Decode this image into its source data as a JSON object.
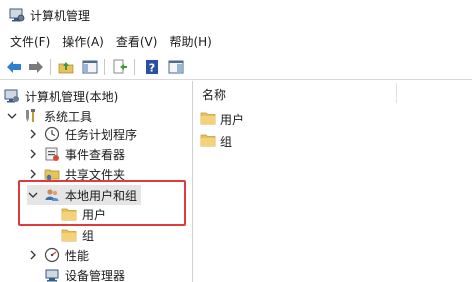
{
  "window": {
    "title": "计算机管理"
  },
  "menu": [
    {
      "label": "文件(F)"
    },
    {
      "label": "操作(A)"
    },
    {
      "label": "查看(V)"
    },
    {
      "label": "帮助(H)"
    }
  ],
  "toolbar": {
    "buttons": [
      "back-icon",
      "forward-icon",
      "up-folder-icon",
      "show-hide-tree-icon",
      "export-list-icon",
      "help-icon",
      "properties-icon"
    ]
  },
  "tree": {
    "items": [
      {
        "label": "计算机管理(本地)",
        "icon": "computer-management-icon",
        "expander": ""
      },
      {
        "label": "系统工具",
        "icon": "system-tools-icon",
        "expander": "expanded"
      },
      {
        "label": "任务计划程序",
        "icon": "task-scheduler-icon",
        "expander": "collapsed"
      },
      {
        "label": "事件查看器",
        "icon": "event-viewer-icon",
        "expander": "collapsed"
      },
      {
        "label": "共享文件夹",
        "icon": "shared-folders-icon",
        "expander": "collapsed"
      },
      {
        "label": "本地用户和组",
        "icon": "local-users-groups-icon",
        "expander": "expanded"
      },
      {
        "label": "用户",
        "icon": "folder-icon",
        "expander": ""
      },
      {
        "label": "组",
        "icon": "folder-icon",
        "expander": ""
      },
      {
        "label": "性能",
        "icon": "performance-icon",
        "expander": "collapsed"
      },
      {
        "label": "设备管理器",
        "icon": "device-manager-icon",
        "expander": ""
      }
    ]
  },
  "list": {
    "header": {
      "name": "名称"
    },
    "rows": [
      {
        "label": "用户",
        "icon": "folder-icon"
      },
      {
        "label": "组",
        "icon": "folder-icon"
      }
    ]
  },
  "colors": {
    "highlight": "#e0393e",
    "selection": "#e5e5e5",
    "folder": "#e8c25a"
  }
}
